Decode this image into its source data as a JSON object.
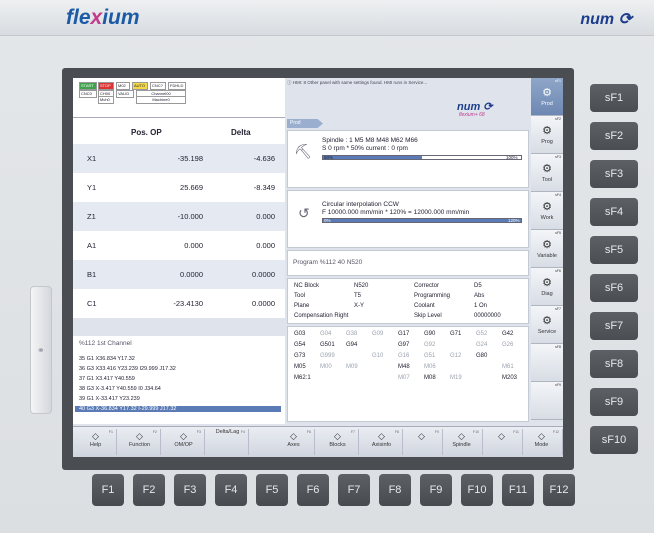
{
  "header": {
    "logo_left_a": "fle",
    "logo_left_x": "x",
    "logo_left_b": "ium",
    "logo_right": "num"
  },
  "status": {
    "start": "START",
    "stop": "STOP",
    "m02": "M02",
    "auto": "AUTO",
    "cnc": "CNC?",
    "fdhld": "FDHLD",
    "cnc0": "CNC0",
    "ch00": "CH00",
    "mch0": "Mch0",
    "valid": "VALID",
    "channel": "Channel00",
    "machine": "Machine0"
  },
  "message": "HMI: 8 Other panel with same settings found. HMI runs in Service...",
  "brand": {
    "num": "num",
    "flexium": "flexium+ 68"
  },
  "vtabs": [
    {
      "label": "Prod",
      "n": "sF1",
      "icon": "gears-icon"
    },
    {
      "label": "Prog",
      "n": "sF2",
      "icon": "program-icon"
    },
    {
      "label": "Tool",
      "n": "sF3",
      "icon": "tool-icon"
    },
    {
      "label": "Work",
      "n": "sF4",
      "icon": "work-icon"
    },
    {
      "label": "Variable",
      "n": "sF5",
      "icon": "variable-icon"
    },
    {
      "label": "Diag",
      "n": "sF6",
      "icon": "diag-icon"
    },
    {
      "label": "Service",
      "n": "sF7",
      "icon": "service-icon"
    },
    {
      "label": "",
      "n": "sF8",
      "icon": ""
    },
    {
      "label": "",
      "n": "sF9",
      "icon": ""
    }
  ],
  "prod_tag": "Prod",
  "positions": {
    "head_pos": "Pos. OP",
    "head_delta": "Delta",
    "rows": [
      {
        "axis": "X1",
        "pos": "-35.198",
        "delta": "-4.636"
      },
      {
        "axis": "Y1",
        "pos": "25.669",
        "delta": "-8.349"
      },
      {
        "axis": "Z1",
        "pos": "-10.000",
        "delta": "0.000"
      },
      {
        "axis": "A1",
        "pos": "0.000",
        "delta": "0.000"
      },
      {
        "axis": "B1",
        "pos": "0.0000",
        "delta": "0.0000"
      },
      {
        "axis": "C1",
        "pos": "-23.4130",
        "delta": "0.0000"
      }
    ]
  },
  "program": {
    "title": "%112 1st Channel",
    "lines": [
      "35 G1 X36.834 Y17.32",
      "36 G3 X33.416 Y23.239 I29.999 J17.32",
      "37 G1 X3.417 Y40.559",
      "38 G3 X-3.417 Y40.559 I0 J34.64",
      "39 G1 X-33.417 Y23.239",
      "40 G3 X-36.834 Y17.32 I-29.999 J17.32"
    ]
  },
  "spindle": {
    "line1": "Spindle : 1    M5 M8 M48 M62 M66",
    "line2": "S 0 rpm * 50% current : 0 rpm",
    "bar_left": "50%",
    "bar_right": "100%",
    "fill": 0.5
  },
  "interp": {
    "line1": "Circular interpolation CCW",
    "line2": "F 10000.000 mm/min * 120% = 12000.000 mm/min",
    "bar_left": "0%",
    "bar_right": "120%",
    "fill": 1.0
  },
  "progline": "Program %112 40 N520",
  "nc": {
    "rows": [
      [
        "NC Block",
        "N520",
        "Corrector",
        "D5"
      ],
      [
        "Tool",
        "T5",
        "Programming",
        "Abs"
      ],
      [
        "Plane",
        "X-Y",
        "Coolant",
        "1 On"
      ],
      [
        "Compensation Right",
        "",
        "Skip Level",
        "00000000"
      ]
    ]
  },
  "gcodes": [
    [
      [
        "G03",
        0
      ],
      [
        "G04",
        1
      ],
      [
        "G38",
        1
      ],
      [
        "G09",
        1
      ],
      [
        "G17",
        0
      ],
      [
        "G90",
        0
      ],
      [
        "G71",
        0
      ],
      [
        "G52",
        1
      ],
      [
        "G42",
        0
      ]
    ],
    [
      [
        "G54",
        0
      ],
      [
        "G501",
        0
      ],
      [
        "G94",
        0
      ],
      [
        "",
        1
      ],
      [
        "G97",
        0
      ],
      [
        "G92",
        1
      ],
      [
        "",
        1
      ],
      [
        "G24",
        1
      ],
      [
        "G26",
        1
      ]
    ],
    [
      [
        "G73",
        0
      ],
      [
        "G999",
        1
      ],
      [
        "",
        1
      ],
      [
        "G10",
        1
      ],
      [
        "G16",
        1
      ],
      [
        "G51",
        1
      ],
      [
        "G12",
        1
      ],
      [
        "G80",
        0
      ],
      [
        "",
        1
      ]
    ],
    [
      [
        "M05",
        0
      ],
      [
        "M00",
        1
      ],
      [
        "M09",
        1
      ],
      [
        "",
        1
      ],
      [
        "M48",
        0
      ],
      [
        "M06",
        1
      ],
      [
        "",
        1
      ],
      [
        "",
        1
      ],
      [
        "M61",
        1
      ]
    ],
    [
      [
        "M62:1",
        0
      ],
      [
        "",
        1
      ],
      [
        "",
        1
      ],
      [
        "",
        1
      ],
      [
        "M07",
        1
      ],
      [
        "M08",
        0
      ],
      [
        "M19",
        1
      ],
      [
        "",
        1
      ],
      [
        "M203",
        0
      ]
    ]
  ],
  "hotkeys": [
    {
      "label": "Help",
      "n": "F1",
      "icon": "help-icon"
    },
    {
      "label": "Function",
      "n": "F2",
      "icon": "function-icon"
    },
    {
      "label": "OM/OP",
      "n": "F3",
      "icon": "omop-icon"
    },
    {
      "label": "Delta/Lag",
      "n": "F4",
      "icon": ""
    },
    {
      "label": "Axes",
      "n": "F6",
      "icon": "axes-icon"
    },
    {
      "label": "Blocks",
      "n": "F7",
      "icon": "blocks-icon"
    },
    {
      "label": "Axisinfo",
      "n": "F8",
      "icon": "axisinfo-icon"
    },
    {
      "label": "",
      "n": "F9",
      "icon": "disabled-icon"
    },
    {
      "label": "Spindle",
      "n": "F10",
      "icon": "spindle-icon"
    },
    {
      "label": "",
      "n": "F11",
      "icon": "disabled-icon"
    },
    {
      "label": "Mode",
      "n": "F12",
      "icon": "mode-icon"
    }
  ],
  "sf_keys": [
    "sF1",
    "sF2",
    "sF3",
    "sF4",
    "sF5",
    "sF6",
    "sF7",
    "sF8",
    "sF9",
    "sF10"
  ],
  "f_keys": [
    "F1",
    "F2",
    "F3",
    "F4",
    "F5",
    "F6",
    "F7",
    "F8",
    "F9",
    "F10",
    "F11",
    "F12"
  ]
}
